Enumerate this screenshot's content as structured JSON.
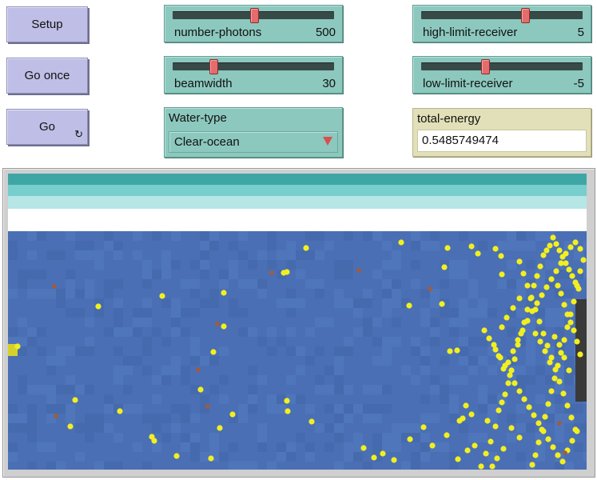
{
  "buttons": {
    "setup": "Setup",
    "go_once": "Go once",
    "go": "Go"
  },
  "sliders": [
    {
      "label": "number-photons",
      "value": "500",
      "fraction": 0.5
    },
    {
      "label": "beamwidth",
      "value": "30",
      "fraction": 0.24
    },
    {
      "label": "high-limit-receiver",
      "value": "5",
      "fraction": 0.65
    },
    {
      "label": "low-limit-receiver",
      "value": "-5",
      "fraction": 0.39
    }
  ],
  "chooser": {
    "label": "Water-type",
    "value": "Clear-ocean"
  },
  "monitor": {
    "label": "total-energy",
    "value": "0.5485749474"
  },
  "icons": {
    "loop": "forever-loop-icon",
    "dropdown": "triangle-down-icon"
  },
  "colors": {
    "button_bg": "#bebee6",
    "slider_bg": "#8cc8be",
    "monitor_bg": "#e2e0b8",
    "water": "#4a6fb4",
    "surface_bands": [
      "#3fa6a6",
      "#78cdcd",
      "#b6e6e6",
      "#ffffff"
    ],
    "photon": "#f2ef20",
    "absorbed": "#a35a3c",
    "receiver": "#3a3a3a",
    "emitter": "#d6d12a"
  }
}
